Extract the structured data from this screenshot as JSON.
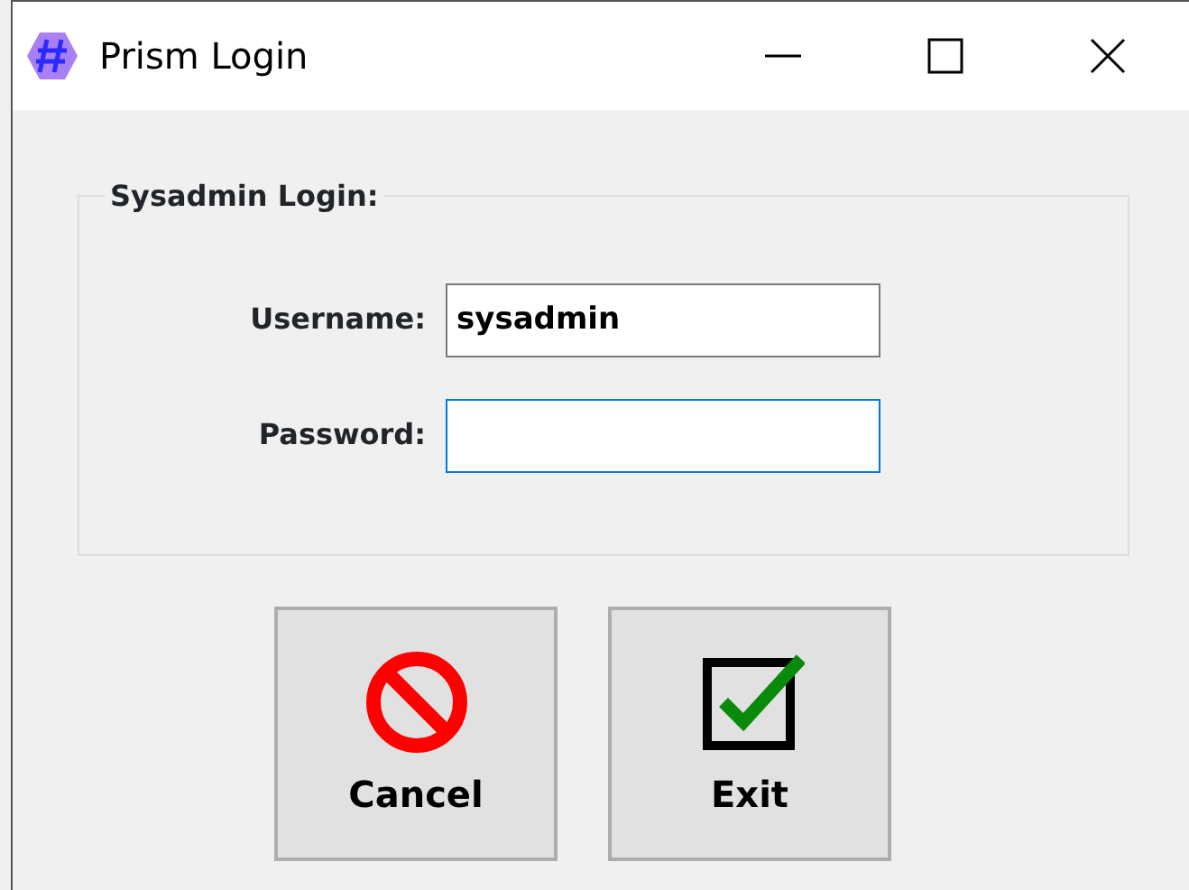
{
  "window": {
    "title": "Prism Login"
  },
  "group": {
    "title": "Sysadmin Login:"
  },
  "fields": [
    {
      "label": "Username:",
      "value": "sysadmin",
      "focused": false
    },
    {
      "label": "Password:",
      "focused": true
    }
  ],
  "buttons": [
    {
      "label": "Cancel",
      "kind": "cancel"
    },
    {
      "label": "Exit",
      "kind": "check"
    }
  ]
}
